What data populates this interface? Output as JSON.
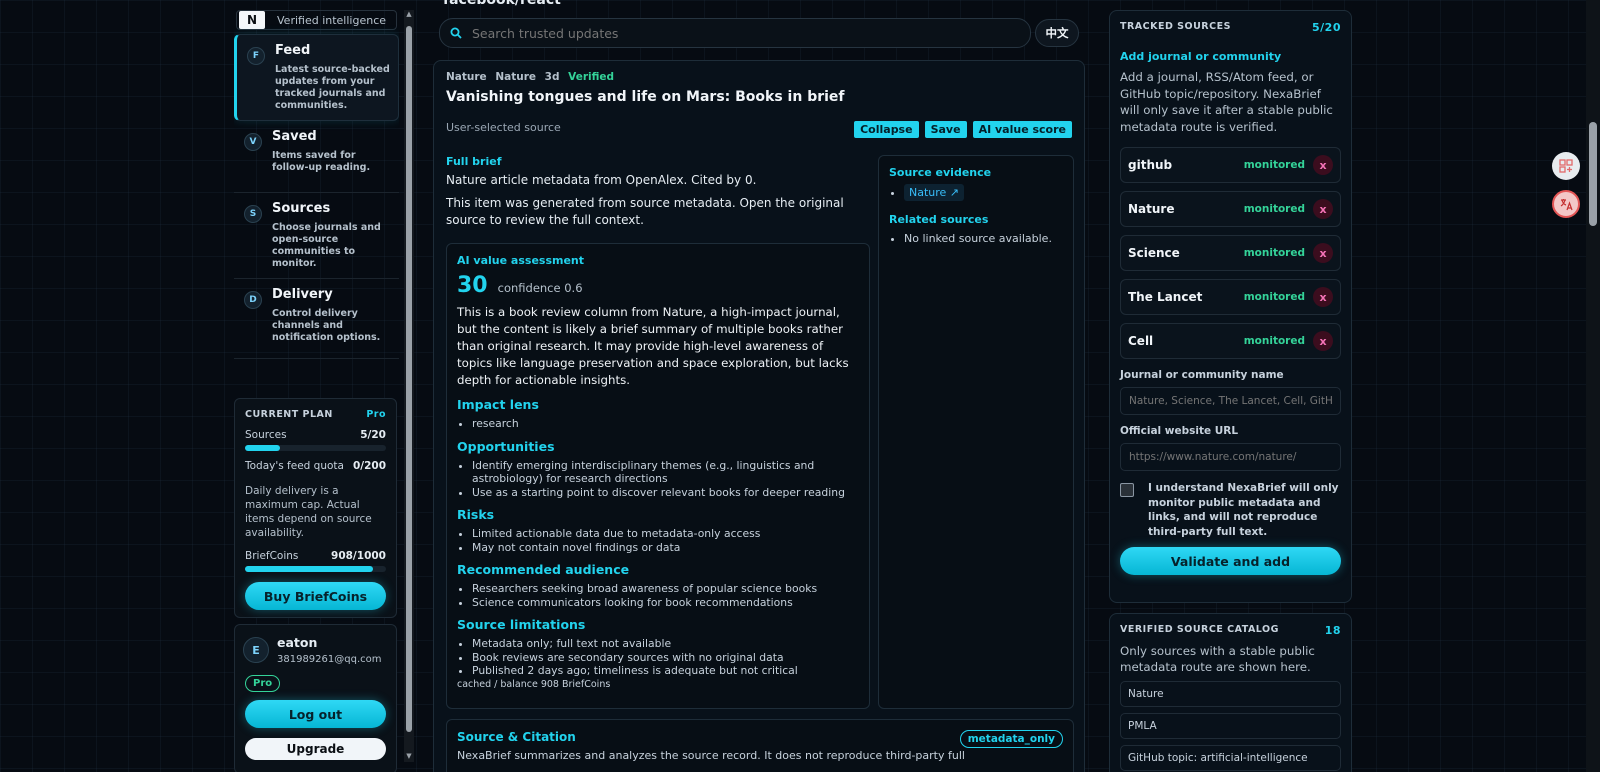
{
  "brand": {
    "logo_letter": "N",
    "tagline": "Verified intelligence"
  },
  "sidebar": {
    "items": [
      {
        "badge": "F",
        "title": "Feed",
        "desc": "Latest source-backed updates from your tracked journals and communities."
      },
      {
        "badge": "V",
        "title": "Saved",
        "desc": "Items saved for follow-up reading."
      },
      {
        "badge": "S",
        "title": "Sources",
        "desc": "Choose journals and open-source communities to monitor."
      },
      {
        "badge": "D",
        "title": "Delivery",
        "desc": "Control delivery channels and notification options."
      }
    ]
  },
  "plan": {
    "heading": "CURRENT PLAN",
    "tier": "Pro",
    "sources_label": "Sources",
    "sources_value": "5/20",
    "sources_fraction": 0.25,
    "quota_label": "Today's feed quota",
    "quota_value": "0/200",
    "note": "Daily delivery is a maximum cap. Actual items depend on source availability.",
    "coins_label": "BriefCoins",
    "coins_value": "908/1000",
    "coins_fraction": 0.908,
    "buy_label": "Buy BriefCoins"
  },
  "user": {
    "initial": "E",
    "name": "eaton",
    "email": "381989261@qq.com",
    "badge": "Pro",
    "logout_label": "Log out",
    "upgrade_label": "Upgrade"
  },
  "header": {
    "repo": "facebook/react",
    "search_placeholder": "Search trusted updates",
    "lang_label": "中文"
  },
  "article": {
    "meta": {
      "source": "Nature",
      "venue": "Nature",
      "age": "3d",
      "status": "Verified"
    },
    "title": "Vanishing tongues and life on Mars: Books in brief",
    "source_note": "User-selected source",
    "actions": {
      "collapse": "Collapse",
      "save": "Save",
      "score": "AI value score"
    },
    "brief": {
      "label": "Full brief",
      "line1": "Nature article metadata from OpenAlex. Cited by 0.",
      "line2": "This item was generated from source metadata. Open the original source to review the full context."
    },
    "ai": {
      "heading": "AI value assessment",
      "score": "30",
      "confidence": "confidence 0.6",
      "summary": "This is a book review column from Nature, a high-impact journal, but the content is likely a brief summary of multiple books rather than original research. It may provide high-level awareness of topics like language preservation and space exploration, but lacks depth for actionable insights.",
      "impact_heading": "Impact lens",
      "impact": [
        "research"
      ],
      "opps_heading": "Opportunities",
      "opportunities": [
        "Identify emerging interdisciplinary themes (e.g., linguistics and astrobiology) for research directions",
        "Use as a starting point to discover relevant books for deeper reading"
      ],
      "risks_heading": "Risks",
      "risks": [
        "Limited actionable data due to metadata-only access",
        "May not contain novel findings or data"
      ],
      "audience_heading": "Recommended audience",
      "audience": [
        "Researchers seeking broad awareness of popular science books",
        "Science communicators looking for book recommendations"
      ],
      "limits_heading": "Source limitations",
      "limitations": [
        "Metadata only; full text not available",
        "Book reviews are secondary sources with no original data",
        "Published 2 days ago; timeliness is adequate but not critical"
      ],
      "cached": "cached / balance 908 BriefCoins"
    },
    "evidence": {
      "heading": "Source evidence",
      "link": "Nature ↗",
      "related_heading": "Related sources",
      "related_empty": "No linked source available."
    },
    "citation": {
      "heading": "Source & Citation",
      "text": "NexaBrief summarizes and analyzes the source record. It does not reproduce third-party full",
      "pill": "metadata_only"
    }
  },
  "tracked": {
    "heading": "TRACKED SOURCES",
    "count": "5/20",
    "add_title": "Add journal or community",
    "add_desc": "Add a journal, RSS/Atom feed, or GitHub topic/repository. NexaBrief will only save it after a stable public metadata route is verified.",
    "sources": [
      {
        "name": "github",
        "status": "monitored",
        "remove": "x"
      },
      {
        "name": "Nature",
        "status": "monitored",
        "remove": "x"
      },
      {
        "name": "Science",
        "status": "monitored",
        "remove": "x"
      },
      {
        "name": "The Lancet",
        "status": "monitored",
        "remove": "x"
      },
      {
        "name": "Cell",
        "status": "monitored",
        "remove": "x"
      }
    ],
    "name_label": "Journal or community name",
    "name_placeholder": "Nature, Science, The Lancet, Cell, GitHub",
    "url_label": "Official website URL",
    "url_placeholder": "https://www.nature.com/nature/",
    "consent": "I understand NexaBrief will only monitor public metadata and links, and will not reproduce third-party full text.",
    "validate_label": "Validate and add"
  },
  "catalog": {
    "heading": "VERIFIED SOURCE CATALOG",
    "count": "18",
    "desc": "Only sources with a stable public metadata route are shown here.",
    "items": [
      "Nature",
      "PMLA",
      "GitHub topic: artificial-intelligence"
    ]
  },
  "colors": {
    "accent": "#22d3ee",
    "success": "#34d399",
    "danger": "#f472b6",
    "background": "#060b12"
  },
  "icons": {
    "search": "search-icon",
    "external": "external-link-icon",
    "remove": "close-icon",
    "grid": "apps-icon",
    "translate": "translate-icon"
  }
}
